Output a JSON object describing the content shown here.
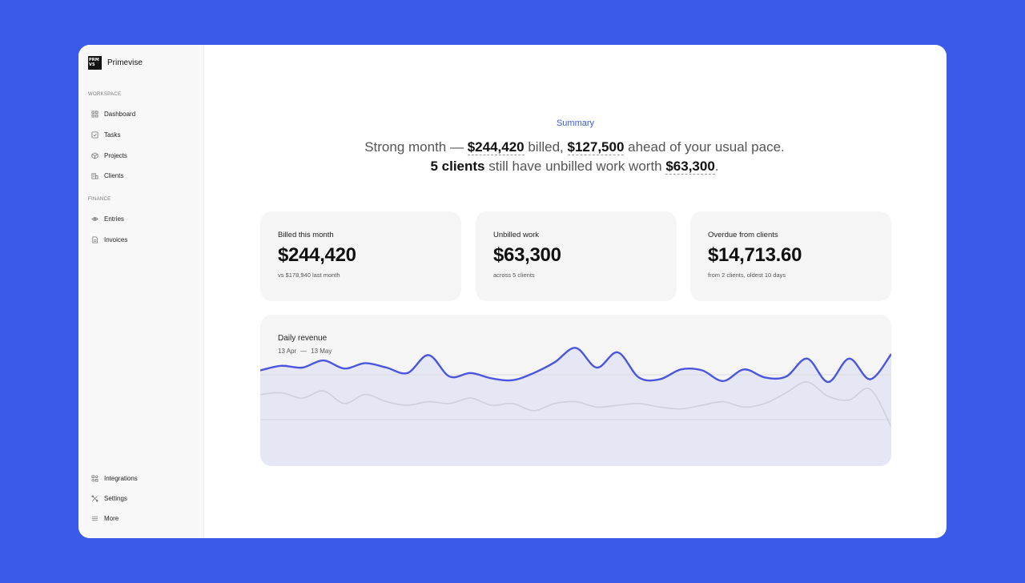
{
  "app": {
    "name": "Primevise",
    "logo_text": "PRM VS"
  },
  "sidebar": {
    "workspace_label": "WORKSPACE",
    "finance_label": "FINANCE",
    "workspace_items": [
      {
        "label": "Dashboard",
        "icon": "dashboard-icon"
      },
      {
        "label": "Tasks",
        "icon": "tasks-icon"
      },
      {
        "label": "Projects",
        "icon": "projects-icon"
      },
      {
        "label": "Clients",
        "icon": "clients-icon"
      }
    ],
    "finance_items": [
      {
        "label": "Entries",
        "icon": "entries-icon"
      },
      {
        "label": "Invoices",
        "icon": "invoices-icon"
      }
    ],
    "bottom_items": [
      {
        "label": "Integrations",
        "icon": "integrations-icon"
      },
      {
        "label": "Settings",
        "icon": "settings-icon"
      },
      {
        "label": "More",
        "icon": "menu-icon"
      }
    ]
  },
  "summary": {
    "label": "Summary",
    "h1": "Strong month — ",
    "billed": "$244,420",
    "h2": " billed, ",
    "ahead": "$127,500",
    "h3": " ahead of your usual pace. ",
    "clients": "5 clients",
    "h4": " still have unbilled work worth ",
    "unbilled": "$63,300",
    "h5": "."
  },
  "cards": [
    {
      "label": "Billed this month",
      "value": "$244,420",
      "sub": "vs $178,940 last month"
    },
    {
      "label": "Unbilled work",
      "value": "$63,300",
      "sub": "across 5 clients"
    },
    {
      "label": "Overdue from clients",
      "value": "$14,713.60",
      "sub": "from 2 clients, oldest 10 days"
    }
  ],
  "revenue": {
    "title": "Daily revenue",
    "start": "13 Apr",
    "dash": "—",
    "end": "13 May"
  },
  "chart_data": {
    "type": "line",
    "title": "Daily revenue",
    "x_start": "13 Apr",
    "x_end": "13 May",
    "grid": true,
    "series": [
      {
        "color": "#4a55e0",
        "values": [
          55,
          60,
          58,
          66,
          57,
          63,
          58,
          52,
          72,
          48,
          52,
          46,
          44,
          52,
          64,
          80,
          58,
          75,
          47,
          45,
          56,
          55,
          43,
          56,
          47,
          48,
          68,
          42,
          68,
          45,
          73
        ]
      },
      {
        "color": "#cfd0dc",
        "values": [
          28,
          30,
          24,
          32,
          18,
          28,
          20,
          16,
          20,
          18,
          24,
          16,
          18,
          10,
          18,
          20,
          14,
          16,
          18,
          14,
          12,
          16,
          20,
          14,
          18,
          30,
          42,
          26,
          22,
          34,
          -8
        ]
      }
    ]
  },
  "colors": {
    "background": "#3a5bea",
    "accent": "#3a5bea",
    "line": "#4a55e0"
  }
}
